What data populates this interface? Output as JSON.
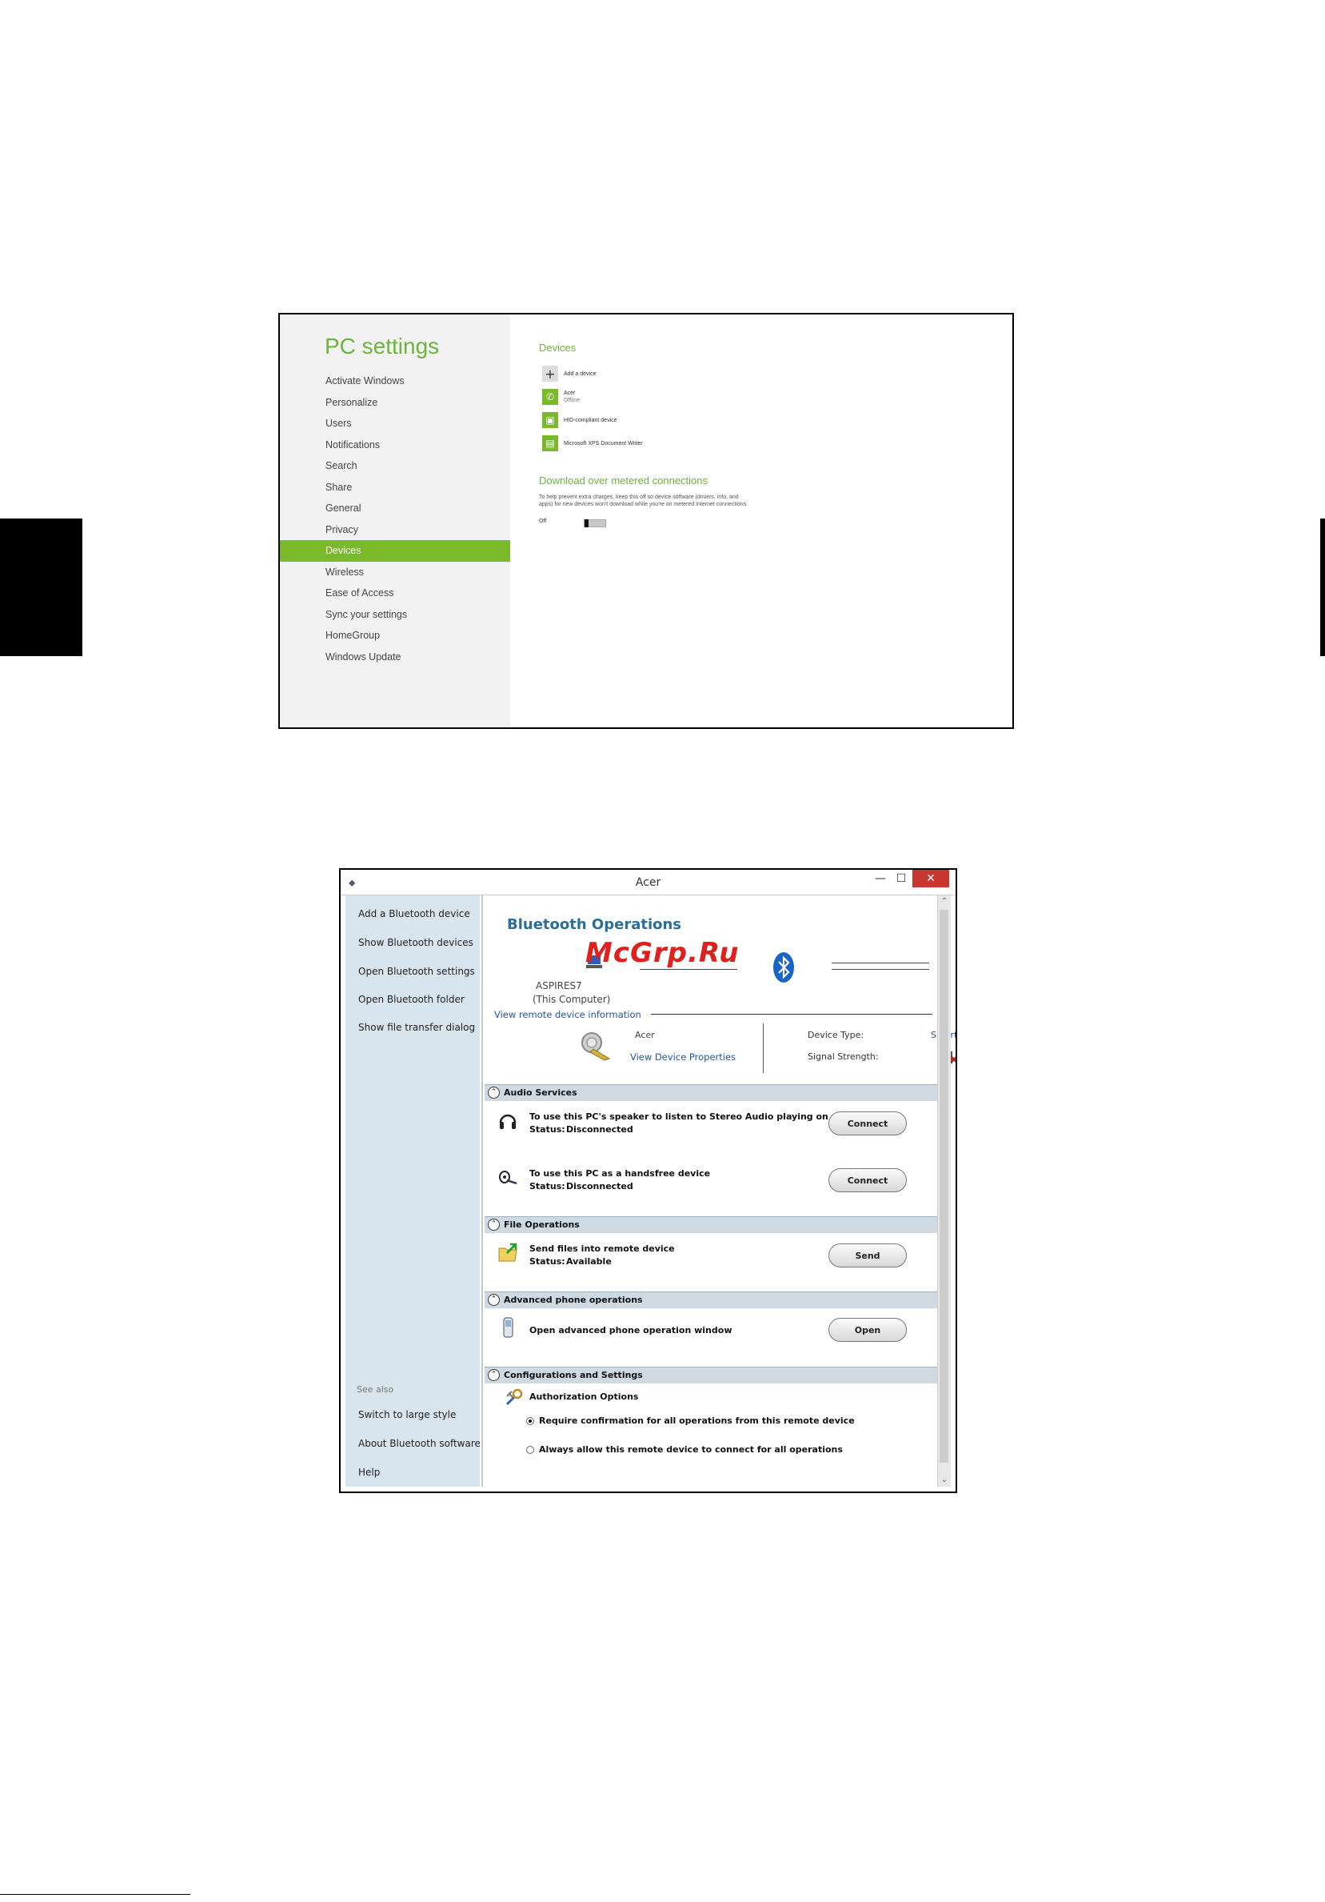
{
  "pc_settings": {
    "title": "PC settings",
    "nav": [
      {
        "label": "Activate Windows"
      },
      {
        "label": "Personalize"
      },
      {
        "label": "Users"
      },
      {
        "label": "Notifications"
      },
      {
        "label": "Search"
      },
      {
        "label": "Share"
      },
      {
        "label": "General"
      },
      {
        "label": "Privacy"
      },
      {
        "label": "Devices",
        "active": true
      },
      {
        "label": "Wireless"
      },
      {
        "label": "Ease of Access"
      },
      {
        "label": "Sync your settings"
      },
      {
        "label": "HomeGroup"
      },
      {
        "label": "Windows Update"
      }
    ],
    "devices_heading": "Devices",
    "add_device": "Add a device",
    "devices": [
      {
        "name": "Acer",
        "status": "Offline",
        "icon": "phone-icon"
      },
      {
        "name": "HID-compliant device",
        "status": "",
        "icon": "hid-device-icon"
      },
      {
        "name": "Microsoft XPS Document Writer",
        "status": "",
        "icon": "printer-icon"
      }
    ],
    "metered_heading": "Download over metered connections",
    "metered_desc": "To help prevent extra charges, keep this off so device software (drivers, info, and apps) for new devices won't download while you're on metered Internet connections.",
    "toggle_label": "Off",
    "accent_color": "#7ab929"
  },
  "bt_window": {
    "title": "Acer",
    "sidebar": [
      "Add a Bluetooth device",
      "Show Bluetooth devices",
      "Open Bluetooth settings",
      "Open Bluetooth folder",
      "Show file transfer dialog"
    ],
    "see_also_label": "See also",
    "see_also": [
      "Switch to large style",
      "About Bluetooth software",
      "Help"
    ],
    "heading": "Bluetooth Operations",
    "watermark": "McGrp.Ru",
    "computer_name": "ASPIRES7",
    "computer_sub": "(This Computer)",
    "view_remote": "View remote device information",
    "device_name": "Acer",
    "device_props": "View Device Properties",
    "device_type_label": "Device Type:",
    "device_type_value": "Smart",
    "signal_label": "Signal Strength:",
    "sections": {
      "audio": {
        "title": "Audio Services",
        "items": [
          {
            "text": "To use this PC's speaker to listen to Stereo Audio playing on",
            "status_label": "Status:",
            "status": "Disconnected",
            "button": "Connect",
            "icon": "headphones-icon"
          },
          {
            "text": "To use this PC as a handsfree device",
            "status_label": "Status:",
            "status": "Disconnected",
            "button": "Connect",
            "icon": "headset-icon"
          }
        ]
      },
      "file": {
        "title": "File Operations",
        "items": [
          {
            "text": "Send files into remote device",
            "status_label": "Status:",
            "status": "Available",
            "button": "Send",
            "icon": "folder-send-icon"
          }
        ]
      },
      "phone": {
        "title": "Advanced phone operations",
        "items": [
          {
            "text": "Open advanced phone operation window",
            "button": "Open",
            "icon": "phone-handset-icon"
          }
        ]
      },
      "config": {
        "title": "Configurations and Settings",
        "auth_title": "Authorization Options",
        "options": [
          {
            "label": "Require confirmation for all operations from this remote device",
            "selected": true
          },
          {
            "label": "Always allow this remote device to connect for all operations",
            "selected": false
          }
        ]
      }
    },
    "accent_color": "#2a6f9a",
    "close_color": "#c7372f"
  }
}
